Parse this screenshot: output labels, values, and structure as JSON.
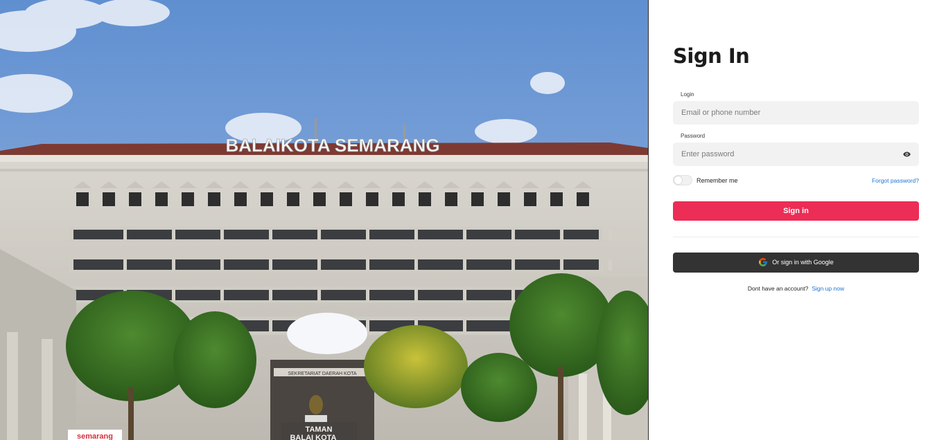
{
  "hero": {
    "building_sign": "BALAIKOTA SEMARANG",
    "garden_sign_line1": "TAMAN",
    "garden_sign_line2": "BALAI KOTA",
    "facade_text": "SEKRETARIAT DAERAH KOTA",
    "corner_brand": "semarang"
  },
  "signin": {
    "title": "Sign In",
    "login_label": "Login",
    "login_placeholder": "Email or phone number",
    "password_label": "Password",
    "password_placeholder": "Enter password",
    "remember_label": "Remember me",
    "remember_checked": false,
    "forgot_link": "Forgot password?",
    "submit_label": "Sign in",
    "google_label": "Or sign in with Google",
    "no_account_text": "Dont have an account?",
    "signup_link": "Sign up now"
  },
  "colors": {
    "primary": "#ec2d55",
    "link": "#1d74d8",
    "google_button": "#333333",
    "input_bg": "#f2f2f2"
  },
  "icons": {
    "password_toggle": "eye-icon",
    "google": "google-logo-icon"
  }
}
